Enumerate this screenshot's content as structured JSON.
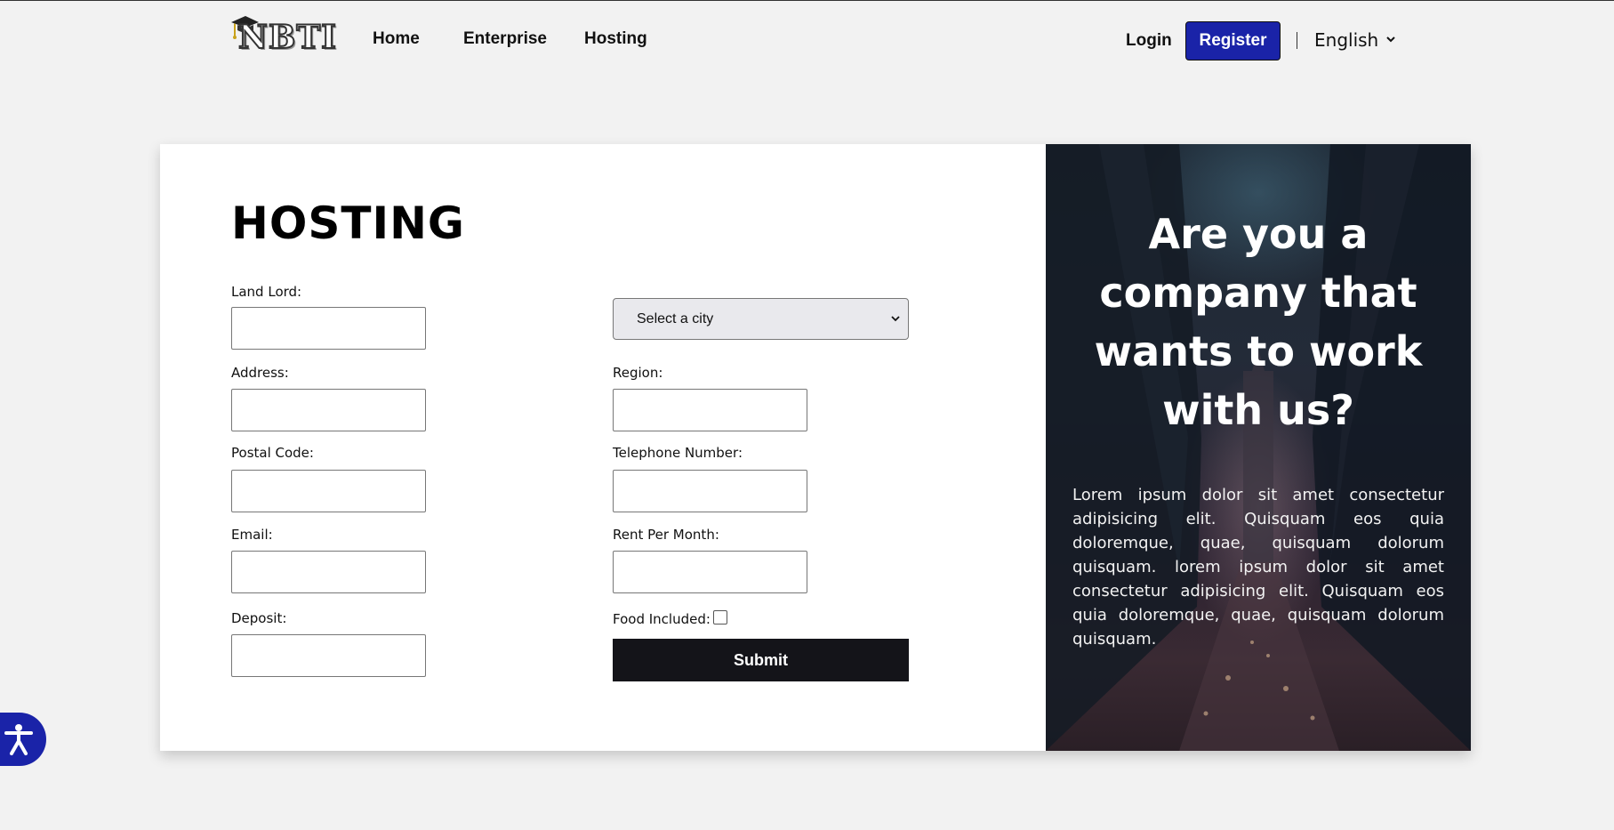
{
  "nav": {
    "logo_text": "NBTI",
    "links": [
      "Home",
      "Enterprise",
      "Hosting"
    ],
    "login": "Login",
    "register": "Register",
    "language": "English"
  },
  "form": {
    "title": "HOSTING",
    "left_labels": {
      "landlord": "Land Lord:",
      "address": "Address:",
      "postal_code": "Postal Code:",
      "email": "Email:",
      "deposit": "Deposit:"
    },
    "right_labels": {
      "region": "Region:",
      "telephone": "Telephone Number:",
      "rent": "Rent Per Month:",
      "food": "Food Included:"
    },
    "city_select": "Select a city",
    "submit": "Submit"
  },
  "promo": {
    "heading": "Are you a company that wants to work with us?",
    "text": "Lorem ipsum dolor sit amet consectetur adipisicing elit. Quisquam eos quia doloremque, quae, quisquam dolorum quisquam. lorem ipsum dolor sit amet consectetur adipisicing elit. Quisquam eos quia doloremque, quae, quisquam dolorum quisquam."
  },
  "colors": {
    "accent": "#1a23a8",
    "submit_bg": "#141419",
    "page_bg": "#f2f2f2"
  },
  "icons": {
    "language_toggle": "chevron-down-icon",
    "accessibility": "accessibility-icon",
    "logo_cap": "graduation-cap-icon"
  }
}
